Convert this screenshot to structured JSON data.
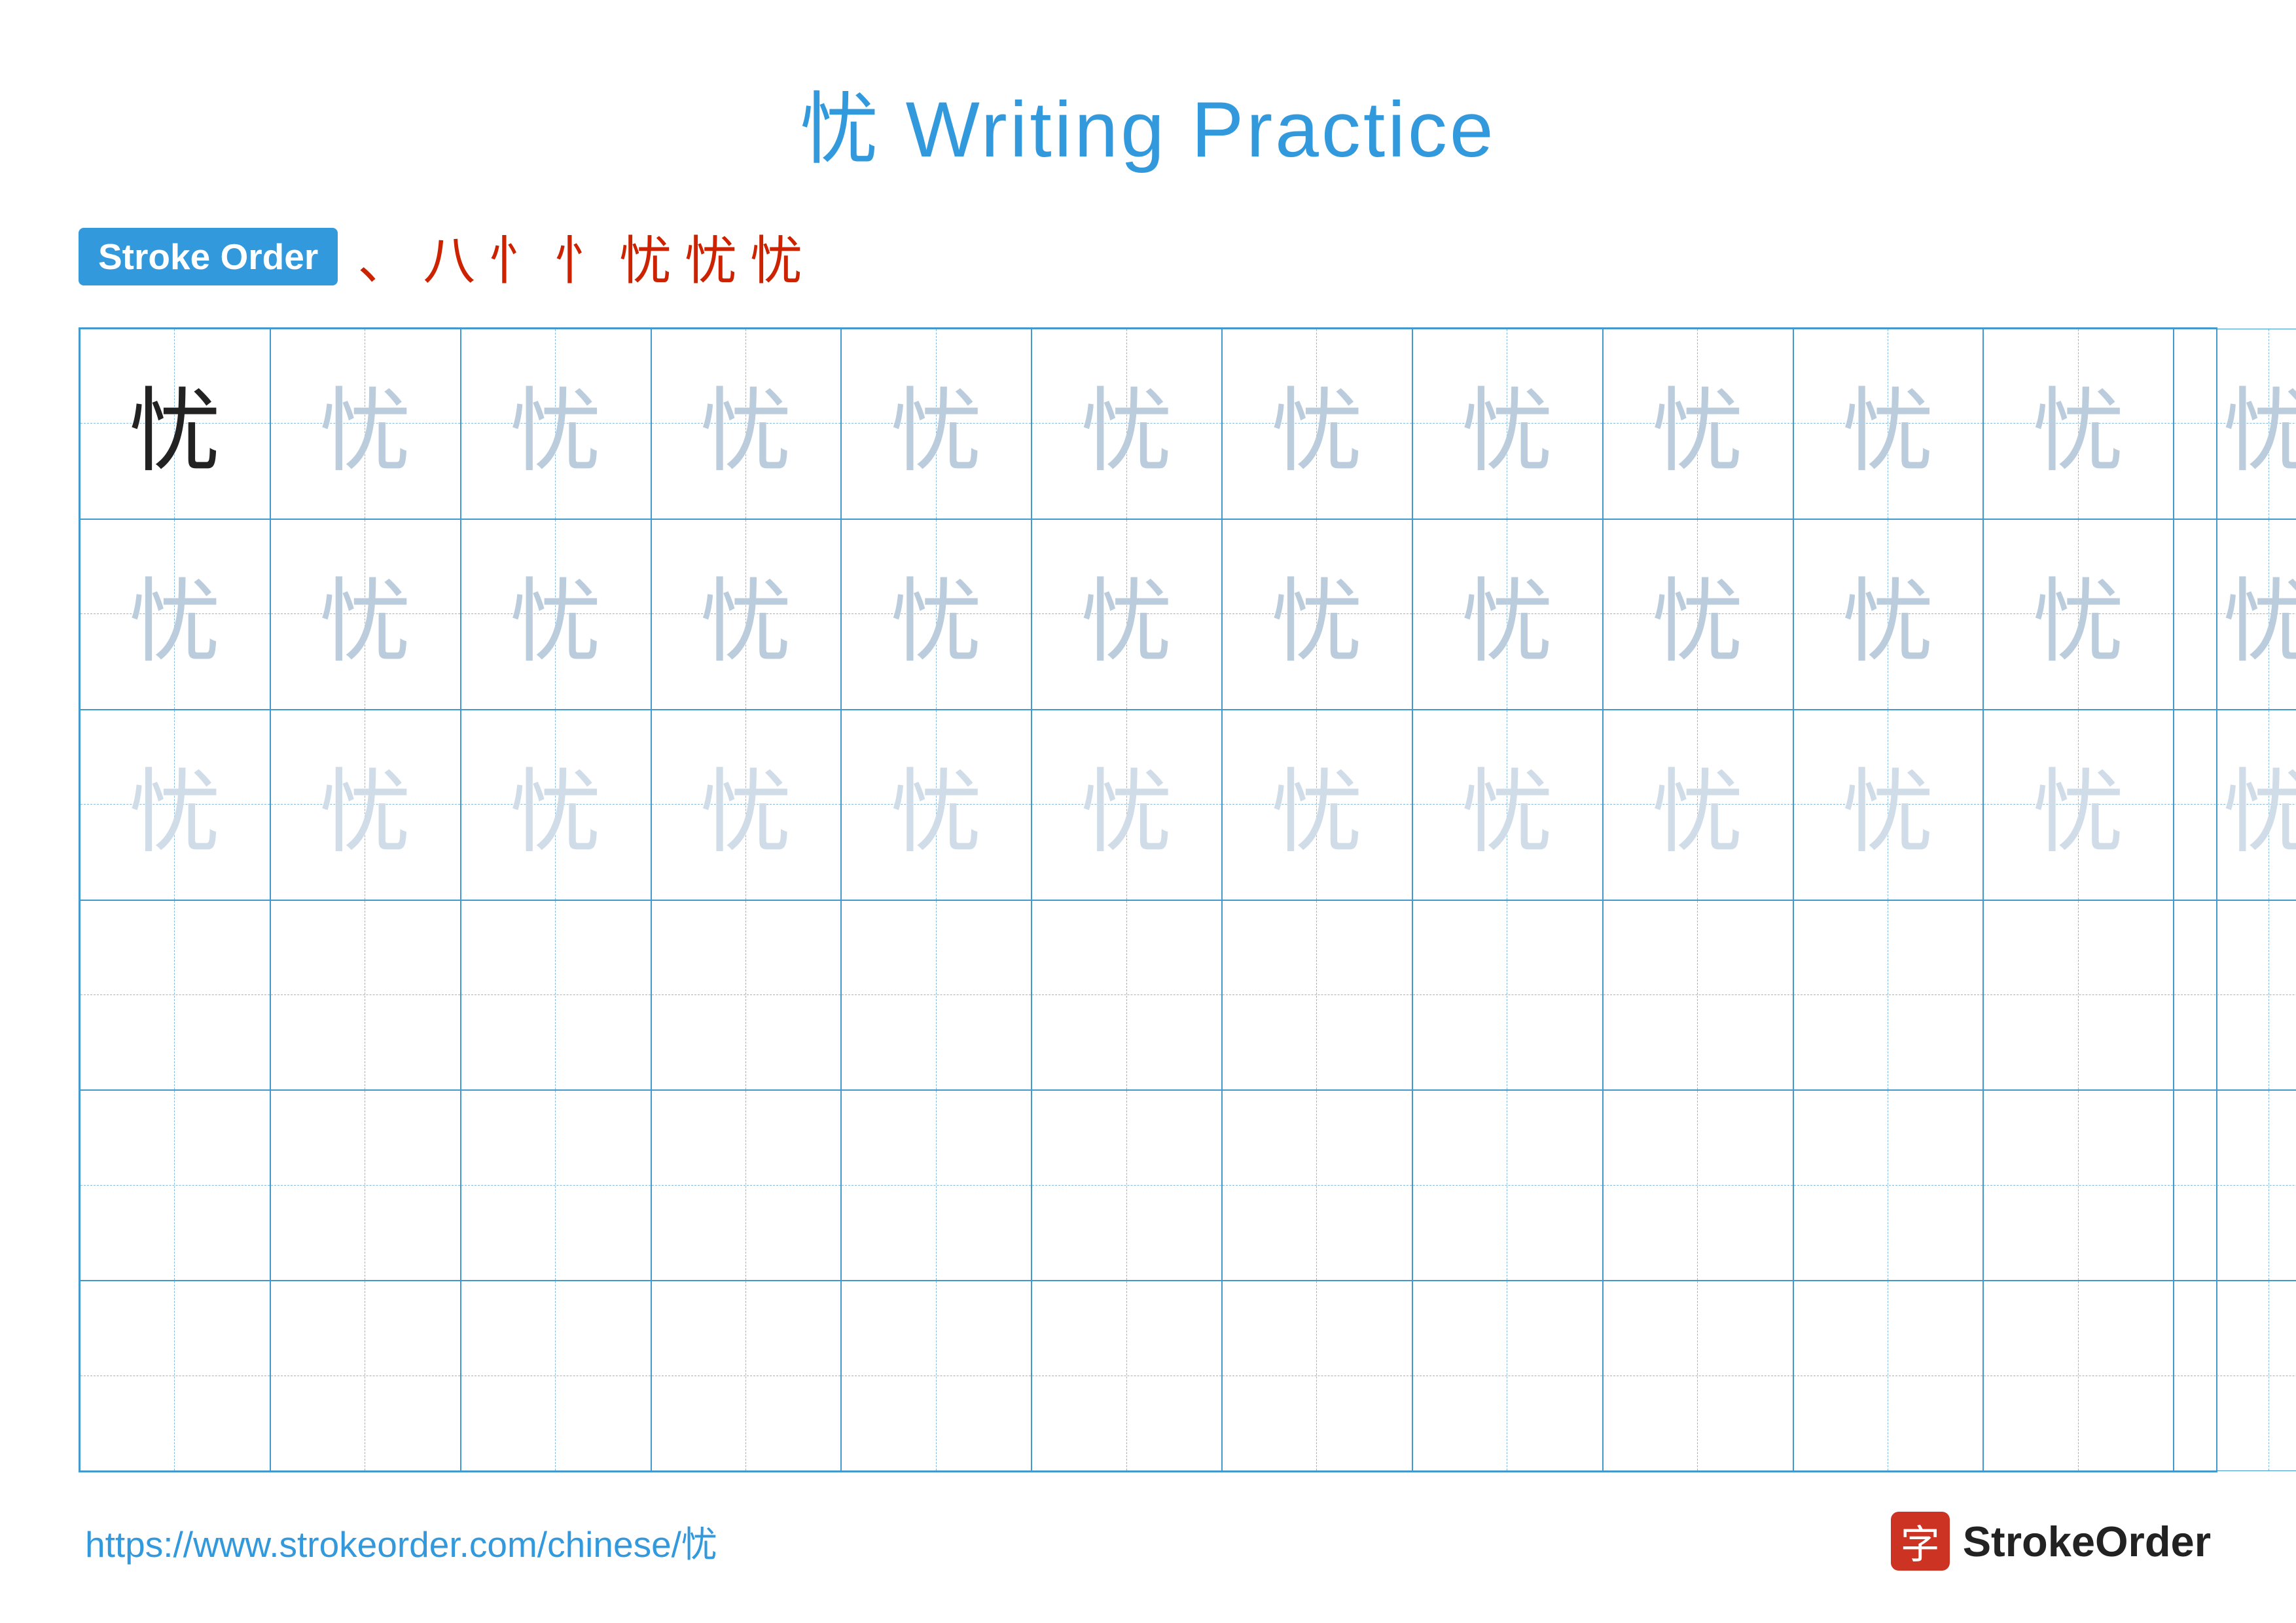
{
  "page": {
    "title": "忧 Writing Practice",
    "title_char": "忧",
    "title_rest": " Writing Practice"
  },
  "stroke_order": {
    "badge_label": "Stroke Order",
    "strokes": [
      "、",
      "八",
      "忄",
      "忄",
      "忧",
      "忧",
      "忧"
    ]
  },
  "grid": {
    "rows": 6,
    "cols": 13,
    "main_char": "忧",
    "row1_type": "dark_then_medium",
    "row2_type": "medium",
    "row3_type": "light",
    "row4_type": "empty",
    "row5_type": "empty",
    "row6_type": "empty"
  },
  "footer": {
    "url": "https://www.strokeorder.com/chinese/忧",
    "logo_char": "字",
    "logo_name": "StrokeOrder"
  }
}
